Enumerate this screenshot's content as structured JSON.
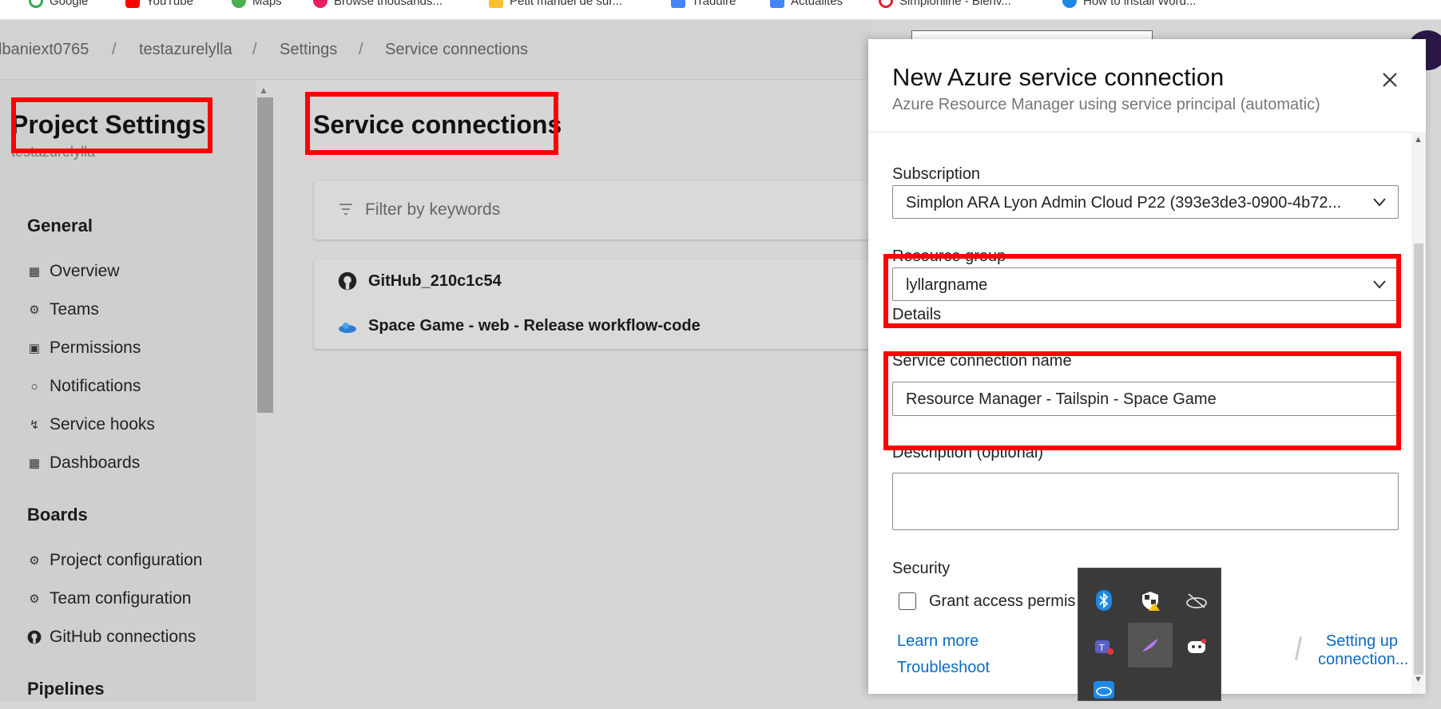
{
  "bookmarks": [
    {
      "label": "Google",
      "color": "#34a853"
    },
    {
      "label": "YouTube",
      "color": "#ff0000"
    },
    {
      "label": "Maps",
      "color": "#4caf50"
    },
    {
      "label": "Browse thousands...",
      "color": "#e91e63"
    },
    {
      "label": "Petit manuel de sur...",
      "color": "#fbc02d"
    },
    {
      "label": "Traduire",
      "color": "#4285f4"
    },
    {
      "label": "Actualités",
      "color": "#4285f4"
    },
    {
      "label": "Simplonline - Bienv...",
      "color": "#e0202f"
    },
    {
      "label": "How to install Word...",
      "color": "#1e88e5"
    }
  ],
  "breadcrumb": {
    "items": [
      "lbaniext0765",
      "testazurelylla",
      "Settings",
      "Service connections"
    ],
    "separator": "/"
  },
  "nav": {
    "title": "Project Settings",
    "subtitle": "testazurelylla",
    "sections": {
      "general": "General",
      "boards": "Boards",
      "pipelines": "Pipelines"
    },
    "general_items": [
      {
        "label": "Overview",
        "icon": "overview-icon"
      },
      {
        "label": "Teams",
        "icon": "teams-icon"
      },
      {
        "label": "Permissions",
        "icon": "lock-icon"
      },
      {
        "label": "Notifications",
        "icon": "chat-icon"
      },
      {
        "label": "Service hooks",
        "icon": "hook-icon"
      },
      {
        "label": "Dashboards",
        "icon": "dashboard-icon"
      }
    ],
    "boards_items": [
      {
        "label": "Project configuration",
        "icon": "config-icon"
      },
      {
        "label": "Team configuration",
        "icon": "team-config-icon"
      },
      {
        "label": "GitHub connections",
        "icon": "github-icon"
      }
    ]
  },
  "main": {
    "title": "Service connections",
    "filter_placeholder": "Filter by keywords",
    "connections": [
      {
        "name": "GitHub_210c1c54",
        "icon": "github-icon"
      },
      {
        "name": "Space Game - web - Release workflow-code",
        "icon": "azure-cloud-icon"
      }
    ]
  },
  "panel": {
    "title": "New Azure service connection",
    "subtitle": "Azure Resource Manager using service principal (automatic)",
    "subscription_label": "Subscription",
    "subscription_value": "Simplon ARA Lyon Admin Cloud P22 (393e3de3-0900-4b72...",
    "resource_group_label": "Resource group",
    "resource_group_value": "lyllargname",
    "details_label": "Details",
    "service_connection_name_label": "Service connection name",
    "service_connection_name_value": "Resource Manager - Tailspin - Space Game",
    "description_label": "Description (optional)",
    "description_value": "",
    "security_label": "Security",
    "grant_access_label": "Grant access permis",
    "learn_more": "Learn more",
    "troubleshoot": "Troubleshoot",
    "setting_up_line1": "Setting up",
    "setting_up_line2": "connection..."
  },
  "tray_icons": [
    "bluetooth-icon",
    "security-warning-icon",
    "cloud-offline-icon",
    "teams-notification-icon",
    "feather-icon",
    "discord-icon",
    "onedrive-icon"
  ],
  "colors": {
    "highlight": "#ff0000",
    "link": "#0a6cc7",
    "tray_bg": "#3a3a3a"
  }
}
